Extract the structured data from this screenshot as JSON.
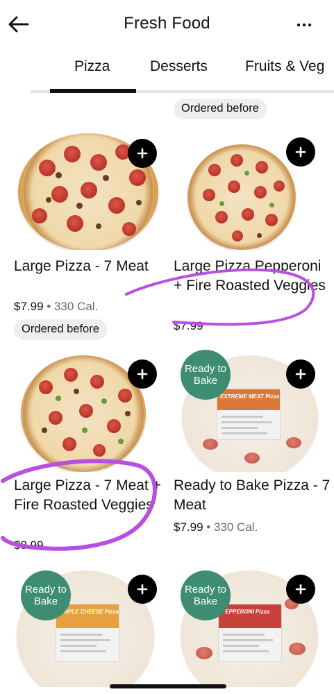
{
  "header": {
    "title": "Fresh Food",
    "back_icon": "arrow-left-icon",
    "more_icon": "more-horizontal-icon"
  },
  "tabs": [
    {
      "label": "Pizza",
      "active": true
    },
    {
      "label": "Desserts",
      "active": false
    },
    {
      "label": "Fruits & Veg",
      "active": false
    }
  ],
  "top_badge": "Ordered before",
  "products": [
    {
      "name": "Large Pizza - 7 Meat",
      "price": "$7.99",
      "separator": "•",
      "calories": "330 Cal.",
      "badge": "Ordered before"
    },
    {
      "name": "Large Pizza Pepperoni + Fire Roasted Veggies",
      "price": "$7.99"
    },
    {
      "name": "Large Pizza - 7 Meat + Fire Roasted Veggies",
      "price": "$8.99"
    },
    {
      "name": "Ready to Bake Pizza - 7 Meat",
      "price": "$7.99",
      "separator": "•",
      "calories": "330 Cal.",
      "tag": "Ready to Bake",
      "package_title": "EXTREME MEAT Pizza"
    },
    {
      "tag": "Ready to Bake",
      "package_title": "TRIPLE CHEESE Pizza"
    },
    {
      "tag": "Ready to Bake",
      "package_title": "PEPPERONI Pizza"
    }
  ],
  "colors": {
    "accent_green": "#3e8c72",
    "annotation_purple": "#b84fe0",
    "label_orange": "#e08a34",
    "label_red": "#c7413a"
  }
}
